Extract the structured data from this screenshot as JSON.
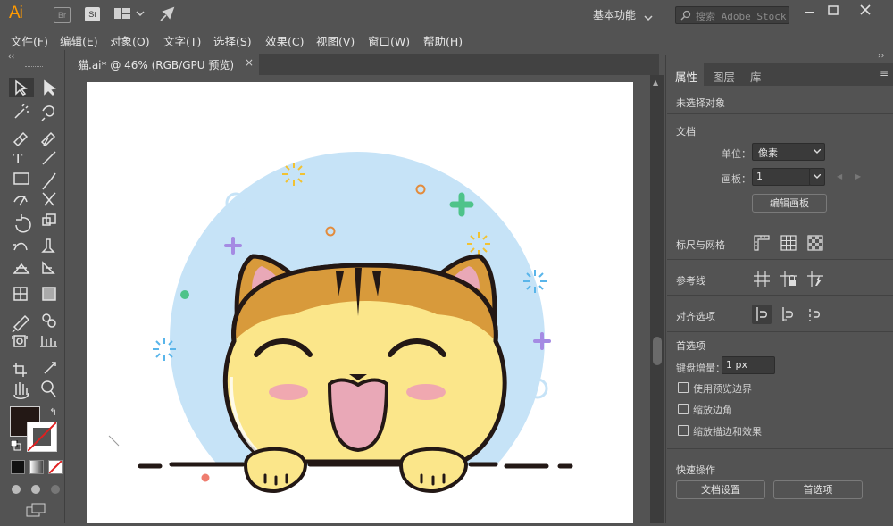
{
  "app": {
    "logo": "Ai",
    "bridge_icon": "Br",
    "stock_icon": "St",
    "workspace": "基本功能",
    "search_placeholder": "搜索 Adobe Stock"
  },
  "menu": [
    "文件(F)",
    "编辑(E)",
    "对象(O)",
    "文字(T)",
    "选择(S)",
    "效果(C)",
    "视图(V)",
    "窗口(W)",
    "帮助(H)"
  ],
  "document_tab": {
    "title": "猫.ai* @ 46% (RGB/GPU 预览)",
    "close": "×"
  },
  "panel": {
    "tabs": [
      "属性",
      "图层",
      "库"
    ],
    "active_tab": "属性",
    "no_selection": "未选择对象",
    "document_section": "文档",
    "unit_label": "单位：",
    "unit_value": "像素",
    "artboard_label": "画板：",
    "artboard_value": "1",
    "edit_artboards_button": "编辑画板",
    "rulers_grids": "标尺与网格",
    "guides": "参考线",
    "snap_options": "对齐选项",
    "preferences": "首选项",
    "keyboard_increment_label": "键盘增量：",
    "keyboard_increment_value": "1 px",
    "checkboxes": [
      "使用预览边界",
      "缩放边角",
      "缩放描边和效果"
    ],
    "quick_actions": "快速操作",
    "document_setup_button": "文档设置",
    "preferences_button": "首选项"
  },
  "colors": {
    "accent": "#ff9a00",
    "fill_swatch": "#231815",
    "cat_body": "#fbe68a",
    "cat_patch": "#d89a3b",
    "circle_bg": "#c6e3f7",
    "tongue": "#e9a8b7",
    "cheek": "#f0a8b0"
  }
}
